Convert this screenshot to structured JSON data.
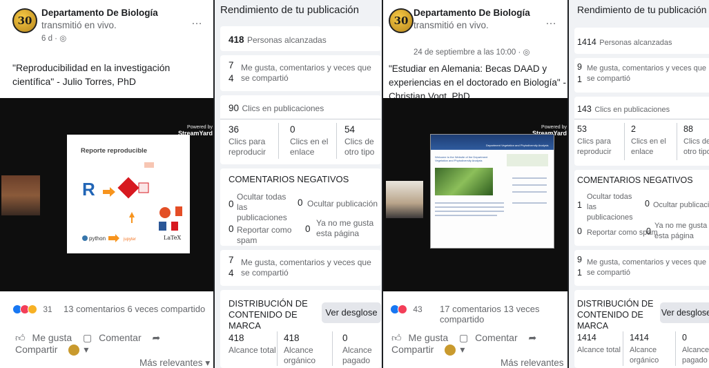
{
  "posts": [
    {
      "page_name": "Departamento De Biología",
      "action": "transmitió en vivo.",
      "time": "6 d · ",
      "privacy_icon": "globe-icon",
      "logo_text": "30 años",
      "text": "\"Reproducibilidad en la investigación científica\" - Julio Torres, PhD",
      "slide_title": "Reporte reproducible",
      "slide_items": [
        "R",
        "python",
        "jupyter",
        "LaTeX"
      ],
      "streamyard": {
        "top": "Powered by",
        "brand": "StreamYard"
      },
      "reaction_icons": [
        "like-icon",
        "love-icon",
        "haha-icon"
      ],
      "reaction_count": "31",
      "comments_shares": "13 comentarios  6 veces compartido",
      "actions": {
        "like": "Me gusta",
        "comment": "Comentar",
        "share": "Compartir"
      },
      "sort": "Más relevantes"
    },
    {
      "page_name": "Departamento De Biología",
      "action": "transmitió en vivo.",
      "time": "24 de septiembre a las 10:00 · ",
      "privacy_icon": "globe-icon",
      "logo_text": "30 años",
      "text": "\"Estudiar en Alemania: Becas DAAD y experiencias en el doctorado en Biología\" - Christian Vogt, PhD",
      "web_title": "Department Vegetation and Phytodiversity Analysis",
      "web_heading": "Welcome to the Website of the Department Vegetation and Phytodiversity Analysis",
      "streamyard": {
        "top": "Powered by",
        "brand": "StreamYard"
      },
      "reaction_icons": [
        "like-icon",
        "love-icon"
      ],
      "reaction_count": "43",
      "comments_shares": "17 comentarios  13 veces compartido",
      "actions": {
        "like": "Me gusta",
        "comment": "Comentar",
        "share": "Compartir"
      },
      "sort": "Más relevantes"
    }
  ],
  "stats": [
    {
      "title": "Rendimiento de tu publicación",
      "reach": {
        "value": "418",
        "label": "Personas alcanzadas"
      },
      "engagement": {
        "top": "7",
        "bottom": "4",
        "label": "Me gusta, comentarios y veces que se compartió"
      },
      "clicks": {
        "value": "90",
        "label": "Clics en publicaciones"
      },
      "click_breakdown": [
        {
          "value": "36",
          "label": "Clics para reproducir"
        },
        {
          "value": "0",
          "label": "Clics en el enlace"
        },
        {
          "value": "54",
          "label": "Clics de otro tipo"
        }
      ],
      "negative_title": "COMENTARIOS NEGATIVOS",
      "negative": [
        {
          "value": "0",
          "label": "Ocultar todas las publicaciones"
        },
        {
          "value": "0",
          "label": "Ocultar publicación"
        },
        {
          "value": "0",
          "label": "Reportar como spam"
        },
        {
          "value": "0",
          "label": "Ya no me gusta esta página"
        }
      ],
      "engagement2": {
        "top": "7",
        "bottom": "4",
        "label": "Me gusta, comentarios y veces que se compartió"
      },
      "brand_title": "DISTRIBUCIÓN DE CONTENIDO DE MARCA",
      "brand_button": "Ver desglose",
      "brand": [
        {
          "value": "418",
          "label": "Alcance total"
        },
        {
          "value": "418",
          "label": "Alcance orgánico"
        },
        {
          "value": "0",
          "label": "Alcance pagado"
        }
      ]
    },
    {
      "title": "Rendimiento de tu publicación",
      "reach": {
        "value": "1414",
        "label": "Personas alcanzadas"
      },
      "engagement": {
        "top": "9",
        "bottom": "1",
        "label": "Me gusta, comentarios y veces que se compartió"
      },
      "clicks": {
        "value": "143",
        "label": "Clics en publicaciones"
      },
      "click_breakdown": [
        {
          "value": "53",
          "label": "Clics para reproducir"
        },
        {
          "value": "2",
          "label": "Clics en el enlace"
        },
        {
          "value": "88",
          "label": "Clics de otro tipo"
        }
      ],
      "negative_title": "COMENTARIOS NEGATIVOS",
      "negative": [
        {
          "value": "1",
          "label": "Ocultar todas las publicaciones"
        },
        {
          "value": "0",
          "label": "Ocultar publicación"
        },
        {
          "value": "0",
          "label": "Reportar como spam"
        },
        {
          "value": "0",
          "label": "Ya no me gusta esta página"
        }
      ],
      "engagement2": {
        "top": "9",
        "bottom": "1",
        "label": "Me gusta, comentarios y veces que se compartió"
      },
      "brand_title": "DISTRIBUCIÓN DE CONTENIDO DE MARCA",
      "brand_button": "Ver desglose",
      "brand": [
        {
          "value": "1414",
          "label": "Alcance total"
        },
        {
          "value": "1414",
          "label": "Alcance orgánico"
        },
        {
          "value": "0",
          "label": "Alcance pagado"
        }
      ]
    }
  ],
  "colors": {
    "accent": "#1877f2",
    "like": "#1877f2",
    "love": "#f33e58",
    "haha": "#f7b125",
    "panel": "#f0f2f5"
  }
}
